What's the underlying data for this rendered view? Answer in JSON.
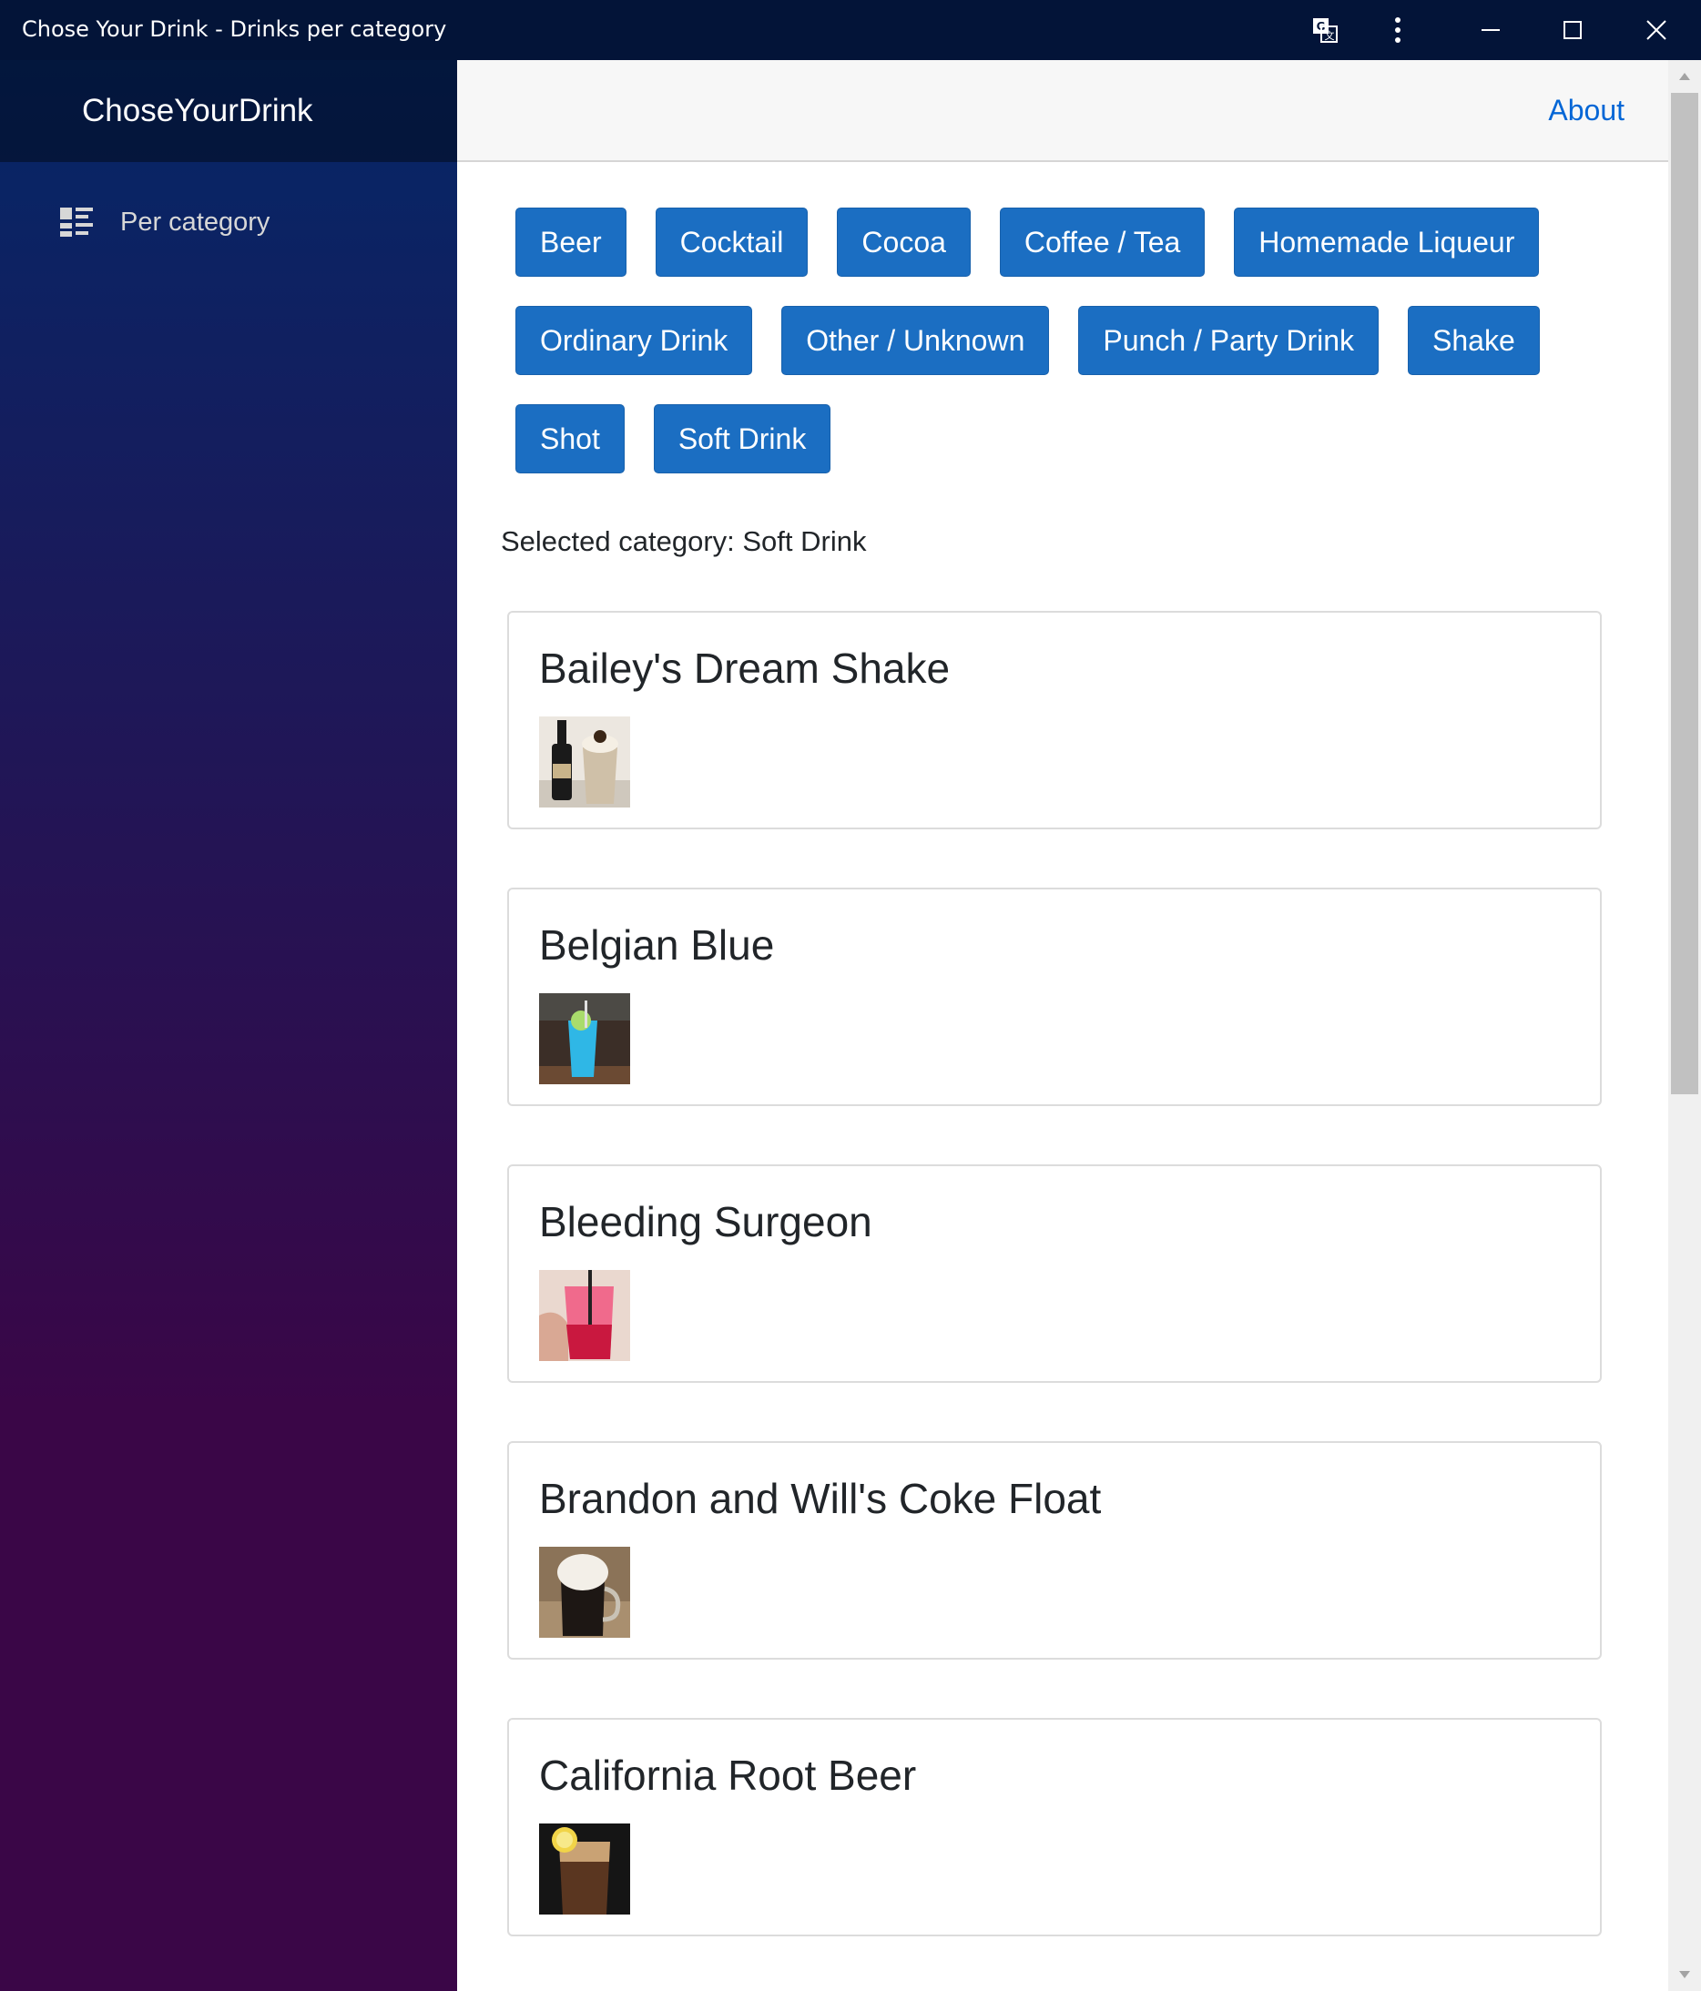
{
  "window": {
    "title": "Chose Your Drink - Drinks per category"
  },
  "sidebar": {
    "brand": "ChoseYourDrink",
    "items": [
      {
        "label": "Per category",
        "icon": "category-list-icon"
      }
    ]
  },
  "topbar": {
    "about_label": "About"
  },
  "categories": [
    "Beer",
    "Cocktail",
    "Cocoa",
    "Coffee / Tea",
    "Homemade Liqueur",
    "Ordinary Drink",
    "Other / Unknown",
    "Punch / Party Drink",
    "Shake",
    "Shot",
    "Soft Drink"
  ],
  "selected": {
    "text": "Selected category: Soft Drink"
  },
  "drinks": [
    {
      "name": "Bailey's Dream Shake"
    },
    {
      "name": "Belgian Blue"
    },
    {
      "name": "Bleeding Surgeon"
    },
    {
      "name": "Brandon and Will's Coke Float"
    },
    {
      "name": "California Root Beer"
    }
  ],
  "colors": {
    "titlebar": "#031438",
    "button": "#1b6ec2",
    "link": "#0366d6",
    "sidebar_top": "#052767",
    "sidebar_bottom": "#3a0647"
  }
}
